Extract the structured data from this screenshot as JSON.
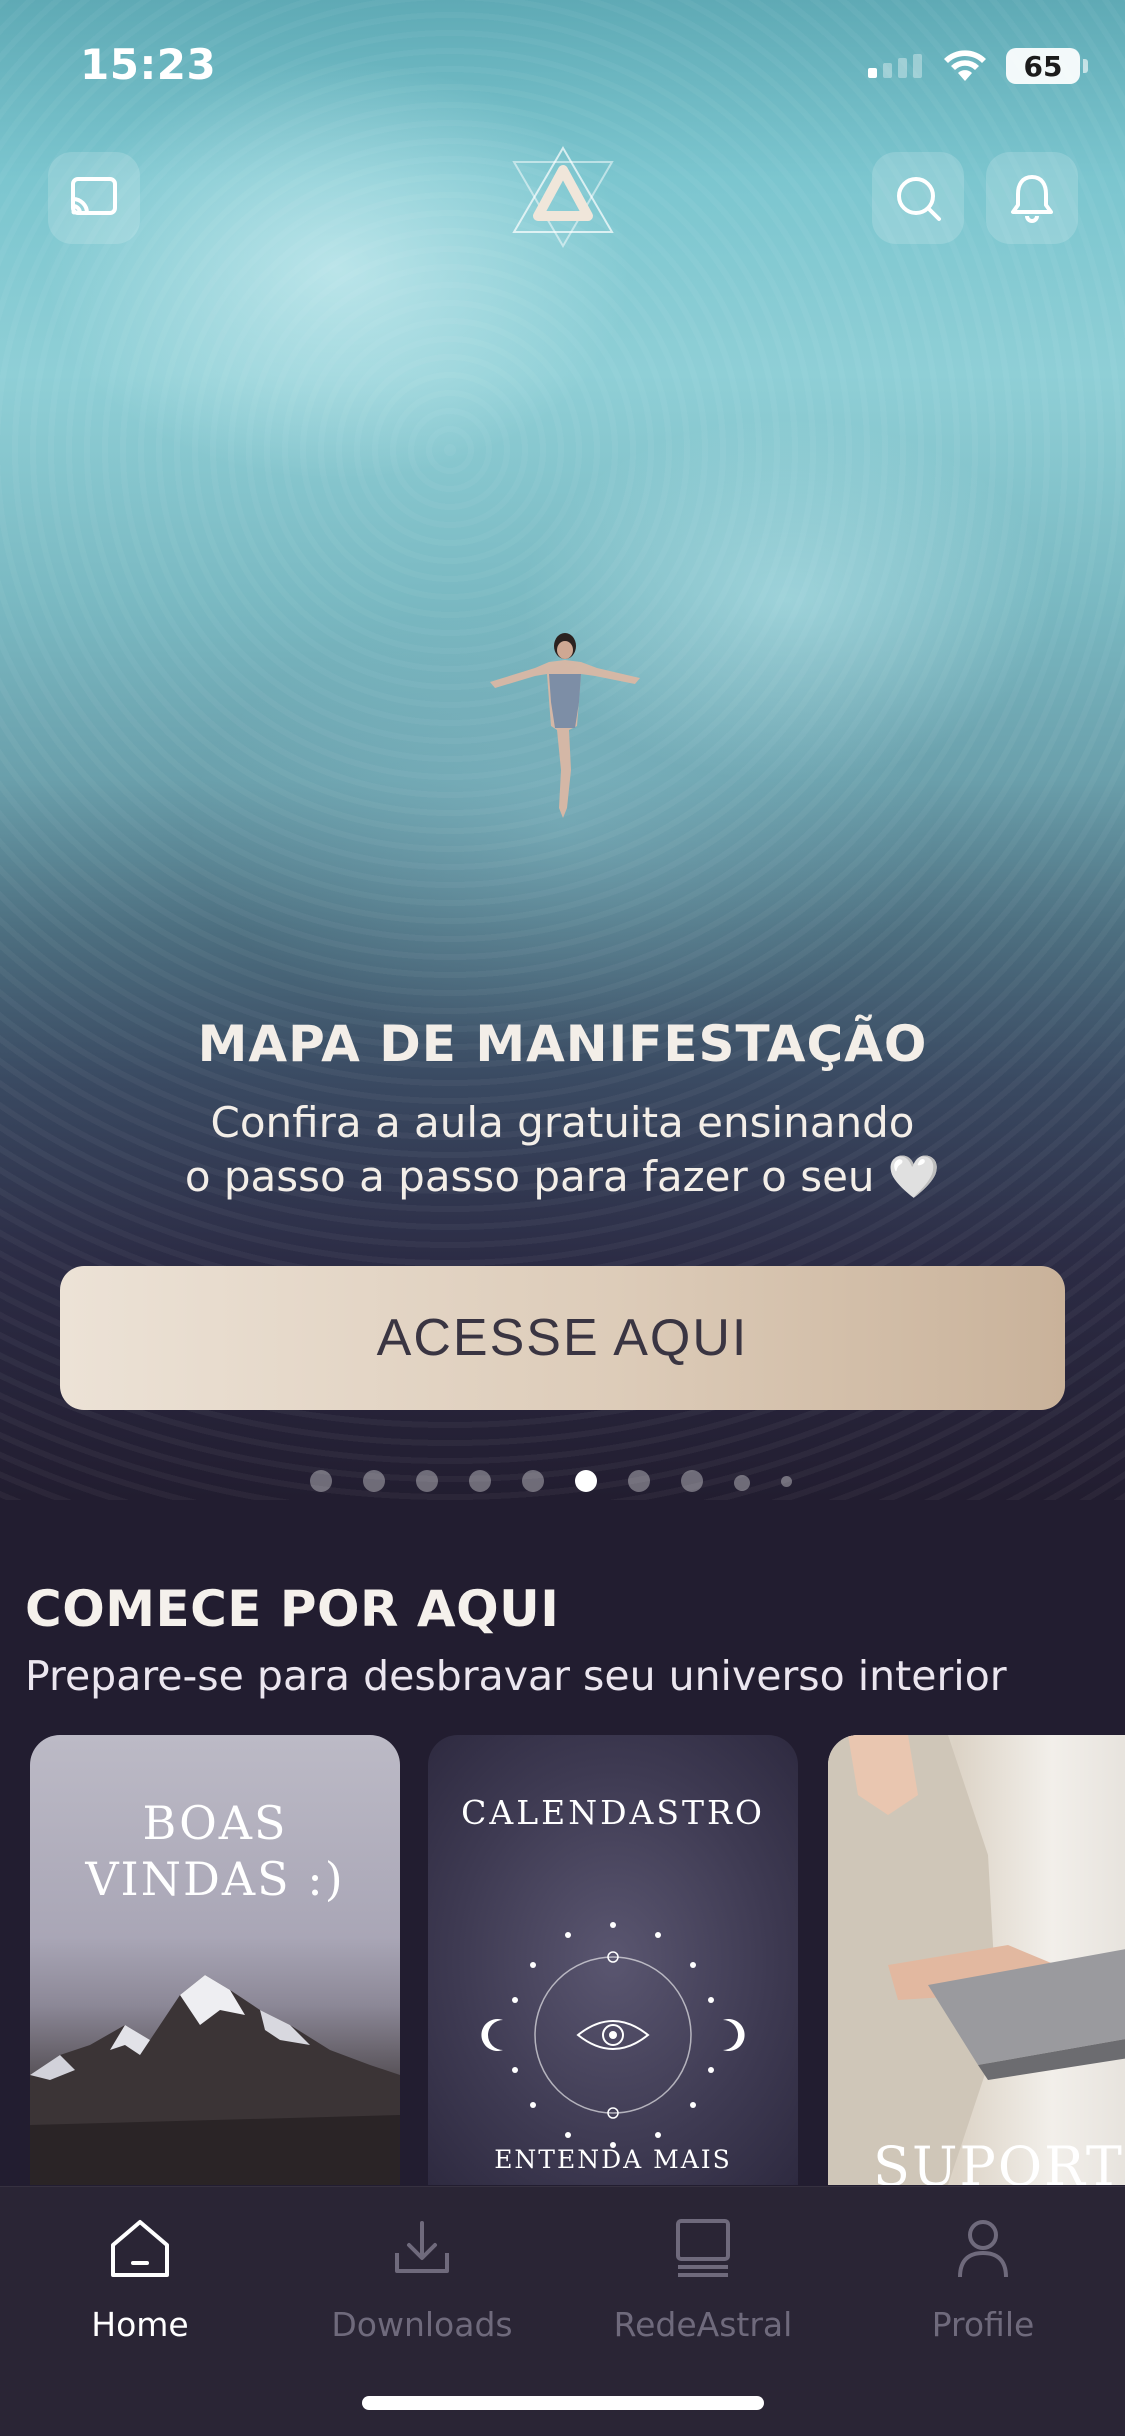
{
  "status_bar": {
    "time": "15:23",
    "battery": "65"
  },
  "header": {
    "cast_icon": "cast-icon",
    "logo_icon": "triangle-logo-icon",
    "search_icon": "search-icon",
    "bell_icon": "bell-icon"
  },
  "hero": {
    "title": "MAPA DE MANIFESTAÇÃO",
    "subtitle_line1": "Confira a aula gratuita ensinando",
    "subtitle_line2": "o passo a passo para fazer o seu 🤍",
    "cta_label": "ACESSE AQUI",
    "carousel_total": 10,
    "carousel_active_index": 5
  },
  "section": {
    "title": "COMECE POR AQUI",
    "subtitle": "Prepare-se para desbravar seu universo interior",
    "cards": [
      {
        "title_line1": "BOAS",
        "title_line2": "VINDAS :)"
      },
      {
        "title": "CALENDASTRO",
        "footer": "ENTENDA MAIS"
      },
      {
        "title": "SUPORTE"
      }
    ]
  },
  "tabbar": {
    "tabs": [
      {
        "label": "Home",
        "icon": "home-icon",
        "active": true
      },
      {
        "label": "Downloads",
        "icon": "download-icon",
        "active": false
      },
      {
        "label": "RedeAstral",
        "icon": "monitor-icon",
        "active": false
      },
      {
        "label": "Profile",
        "icon": "profile-icon",
        "active": false
      }
    ]
  },
  "colors": {
    "background": "#221d30",
    "cta_gradient_start": "#ece2d6",
    "cta_gradient_end": "#c9b29a",
    "tab_inactive": "#6f6a7c"
  }
}
